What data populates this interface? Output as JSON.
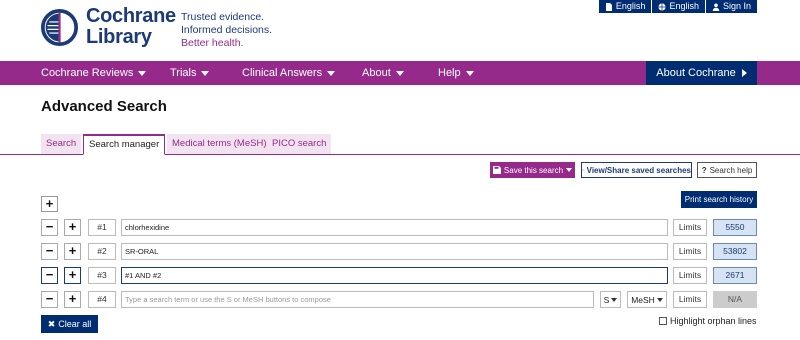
{
  "utility_bar": {
    "items": [
      {
        "icon": "document-icon",
        "label": "English"
      },
      {
        "icon": "globe-icon",
        "label": "English"
      },
      {
        "icon": "user-icon",
        "label": "Sign In"
      }
    ]
  },
  "header": {
    "logo_line1": "Cochrane",
    "logo_line2": "Library",
    "tagline_1": "Trusted evidence.",
    "tagline_2": "Informed decisions.",
    "tagline_3": "Better health."
  },
  "nav": {
    "items": [
      "Cochrane Reviews",
      "Trials",
      "Clinical Answers",
      "About",
      "Help"
    ],
    "about_cochrane": "About Cochrane"
  },
  "page_title": "Advanced Search",
  "tabs": [
    "Search",
    "Search manager",
    "Medical terms (MeSH)",
    "PICO search"
  ],
  "active_tab": "Search manager",
  "actions": {
    "save_search": "Save this search",
    "view_share": "View/Share saved searches",
    "search_help": "Search help",
    "print_history": "Print search history"
  },
  "rows": [
    {
      "number": "#1",
      "term": "chlorhexidine",
      "limits": "Limits",
      "hits": "5550"
    },
    {
      "number": "#2",
      "term": "SR-ORAL",
      "limits": "Limits",
      "hits": "53802"
    },
    {
      "number": "#3",
      "term": "#1 AND #2",
      "limits": "Limits",
      "hits": "2671"
    },
    {
      "number": "#4",
      "placeholder": "Type a search term or use the S or MeSH buttons to compose",
      "s_button": "S",
      "mesh_button": "MeSH",
      "limits": "Limits",
      "hits": "N/A"
    }
  ],
  "clear_all": "Clear all",
  "highlight_orphan": "Highlight orphan lines",
  "colors": {
    "brand_purple": "#962a8b",
    "brand_navy": "#002d72",
    "hits_bg": "#d6e3f3"
  }
}
